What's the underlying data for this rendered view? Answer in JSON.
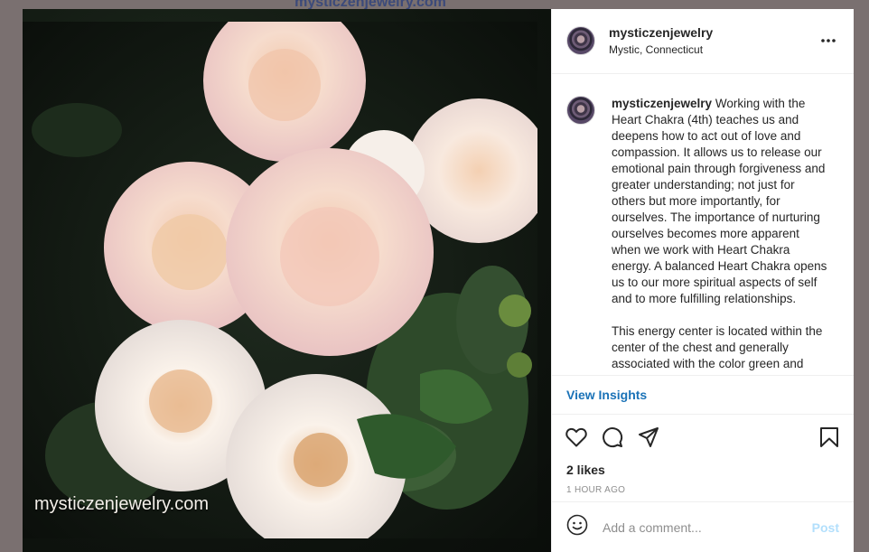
{
  "background": {
    "site_title": "mysticzenjewelry.com"
  },
  "photo": {
    "watermark": "mysticzenjewelry.com",
    "subject": "pale-pink-roses-with-raindrops"
  },
  "header": {
    "username": "mysticzenjewelry",
    "location": "Mystic, Connecticut",
    "more_icon": "more-horizontal-icon"
  },
  "caption": {
    "username": "mysticzenjewelry",
    "paragraph_1": "Working with the Heart Chakra (4th) teaches us and deepens how to act out of love and compassion. It allows us to release our emotional pain through forgiveness and greater understanding; not just for others but more importantly, for ourselves. The importance of nurturing ourselves becomes more apparent when we work with Heart Chakra energy. A balanced Heart Chakra opens us to our more spiritual aspects of self and to more fulfilling relationships.",
    "paragraph_2": "This energy center is located within the center of the chest and generally associated with the color green and"
  },
  "insights": {
    "label": "View Insights"
  },
  "actions": {
    "like_icon": "heart-icon",
    "comment_icon": "comment-icon",
    "share_icon": "share-icon",
    "save_icon": "bookmark-icon"
  },
  "stats": {
    "likes": "2 likes",
    "time": "1 HOUR AGO"
  },
  "comment": {
    "placeholder": "Add a comment...",
    "post_label": "Post",
    "emoji_icon": "smiley-icon"
  },
  "colors": {
    "link_blue": "#1a72b7",
    "post_disabled": "#b2dffc",
    "muted": "#8e8e8e"
  }
}
